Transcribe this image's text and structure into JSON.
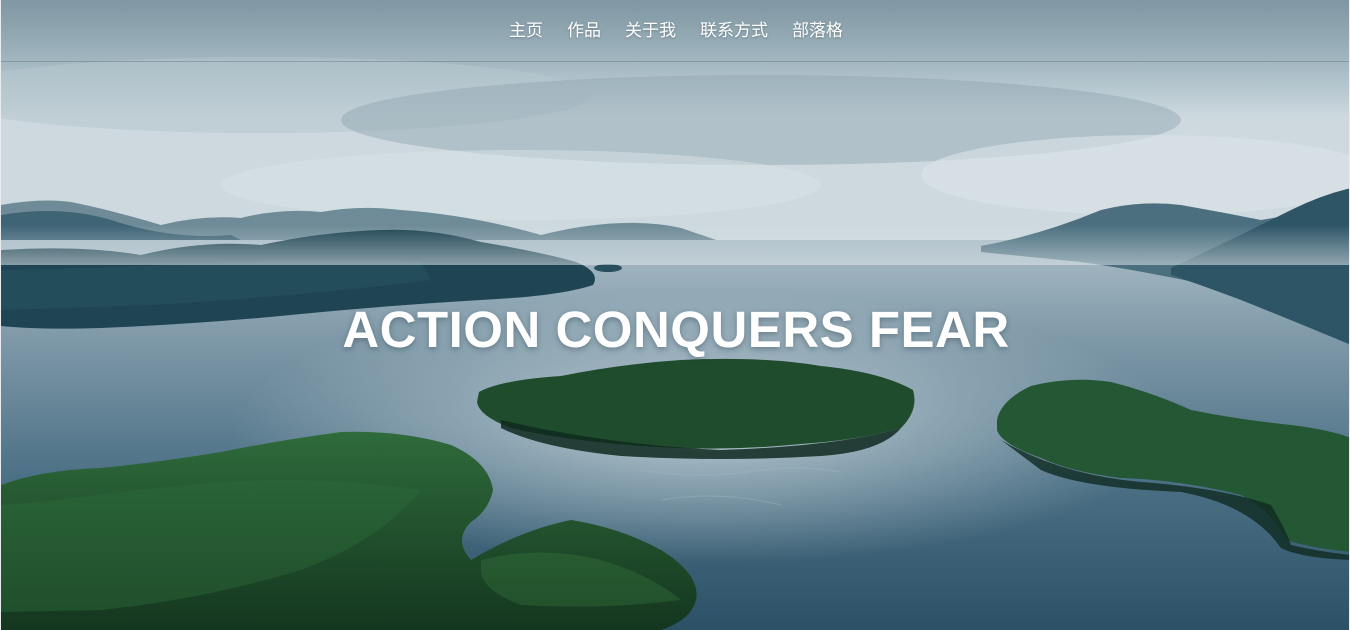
{
  "nav": {
    "items": [
      {
        "label": "主页"
      },
      {
        "label": "作品"
      },
      {
        "label": "关于我"
      },
      {
        "label": "联系方式"
      },
      {
        "label": "部落格"
      }
    ]
  },
  "hero": {
    "headline": "ACTION CONQUERS FEAR"
  },
  "colors": {
    "sky": "#9fb3bd",
    "water": "#3d6277",
    "forest": "#1f4a2e",
    "nav_text": "#ffffff",
    "headline_text": "#ffffff"
  }
}
